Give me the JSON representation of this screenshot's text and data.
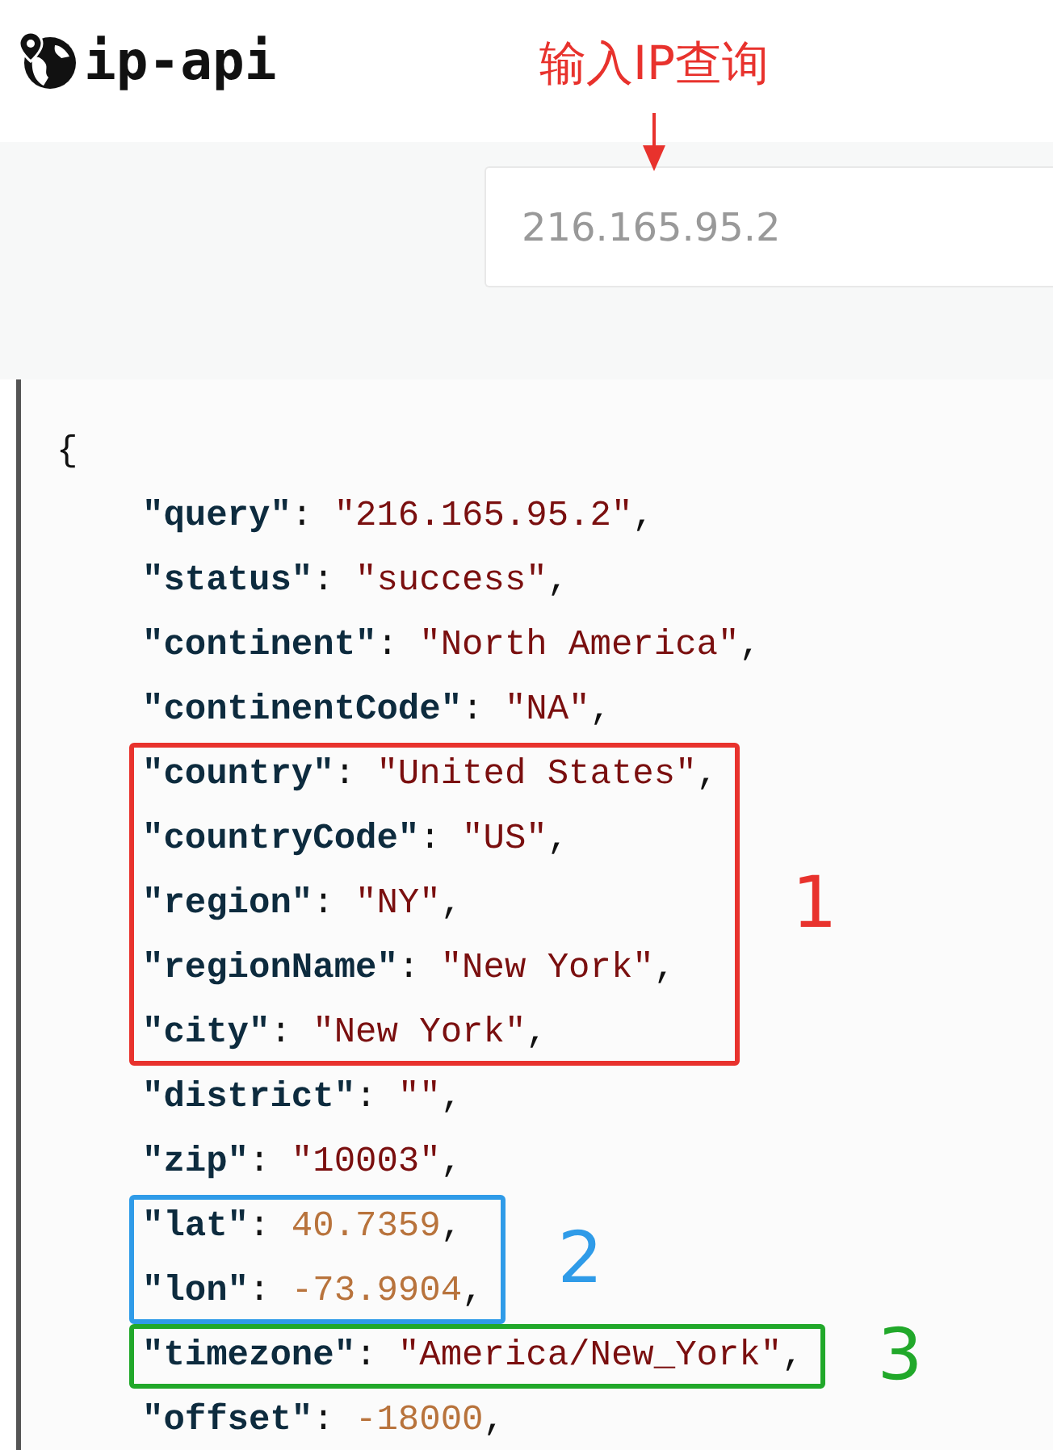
{
  "logo": {
    "text": "ip-api"
  },
  "callout": {
    "text": "输入IP查询",
    "color": "#e8322d"
  },
  "search": {
    "placeholder": "216.165.95.2"
  },
  "result": {
    "open": "{",
    "body": [
      {
        "kind": "string",
        "key": "\"query\"",
        "sep": ": ",
        "value": "\"216.165.95.2\"",
        "end": ","
      },
      {
        "kind": "string",
        "key": "\"status\"",
        "sep": ": ",
        "value": "\"success\"",
        "end": ","
      },
      {
        "kind": "string",
        "key": "\"continent\"",
        "sep": ": ",
        "value": "\"North America\"",
        "end": ","
      },
      {
        "kind": "string",
        "key": "\"continentCode\"",
        "sep": ": ",
        "value": "\"NA\"",
        "end": ","
      },
      {
        "kind": "group",
        "label": "1",
        "color": "#e8322d",
        "lines": [
          {
            "kind": "string",
            "key": "\"country\"",
            "sep": ": ",
            "value": "\"United States\"",
            "end": ","
          },
          {
            "kind": "string",
            "key": "\"countryCode\"",
            "sep": ": ",
            "value": "\"US\"",
            "end": ","
          },
          {
            "kind": "string",
            "key": "\"region\"",
            "sep": ": ",
            "value": "\"NY\"",
            "end": ","
          },
          {
            "kind": "string",
            "key": "\"regionName\"",
            "sep": ": ",
            "value": "\"New York\"",
            "end": ","
          },
          {
            "kind": "string",
            "key": "\"city\"",
            "sep": ": ",
            "value": "\"New York\"",
            "end": ","
          }
        ]
      },
      {
        "kind": "string",
        "key": "\"district\"",
        "sep": ": ",
        "value": "\"\"",
        "end": ","
      },
      {
        "kind": "string",
        "key": "\"zip\"",
        "sep": ": ",
        "value": "\"10003\"",
        "end": ","
      },
      {
        "kind": "group",
        "label": "2",
        "color": "#2f9be8",
        "lines": [
          {
            "kind": "number",
            "key": "\"lat\"",
            "sep": ": ",
            "value": "40.7359",
            "end": ","
          },
          {
            "kind": "number",
            "key": "\"lon\"",
            "sep": ": ",
            "value": "-73.9904",
            "end": ","
          }
        ]
      },
      {
        "kind": "group",
        "label": "3",
        "color": "#21a82a",
        "lines": [
          {
            "kind": "string",
            "key": "\"timezone\"",
            "sep": ": ",
            "value": "\"America/New_York\"",
            "end": ","
          }
        ]
      },
      {
        "kind": "number",
        "key": "\"offset\"",
        "sep": ": ",
        "value": "-18000",
        "end": ","
      }
    ]
  }
}
